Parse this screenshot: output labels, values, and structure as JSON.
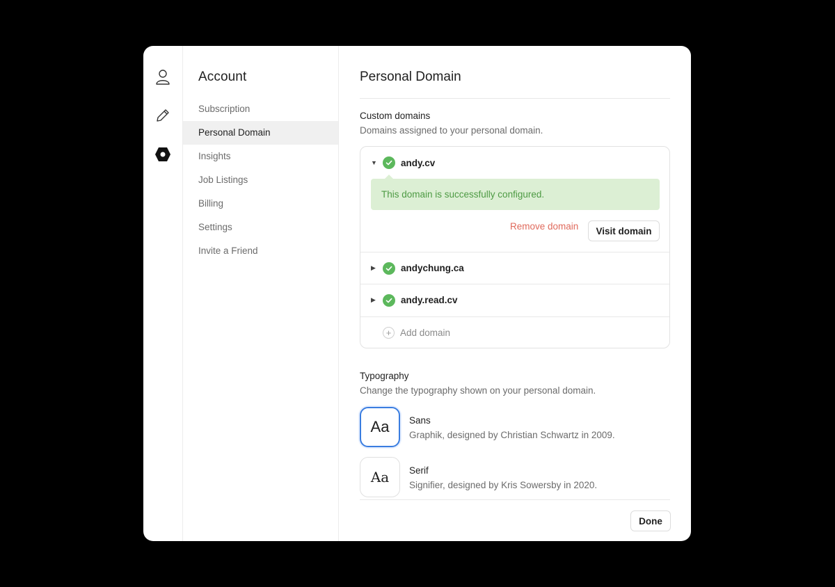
{
  "nav": {
    "title": "Account",
    "items": [
      {
        "label": "Subscription"
      },
      {
        "label": "Personal Domain"
      },
      {
        "label": "Insights"
      },
      {
        "label": "Job Listings"
      },
      {
        "label": "Billing"
      },
      {
        "label": "Settings"
      },
      {
        "label": "Invite a Friend"
      }
    ],
    "active_item": "Personal Domain"
  },
  "rail": {
    "icons": [
      "user-icon",
      "pencil-icon",
      "hexagon-icon"
    ]
  },
  "main": {
    "title": "Personal Domain",
    "custom_domains": {
      "title": "Custom domains",
      "description": "Domains assigned to your personal domain.",
      "domains": [
        {
          "name": "andy.cv",
          "expanded": true,
          "status": "configured"
        },
        {
          "name": "andychung.ca",
          "expanded": false,
          "status": "configured"
        },
        {
          "name": "andy.read.cv",
          "expanded": false,
          "status": "configured"
        }
      ],
      "success_message": "This domain is successfully configured.",
      "remove_label": "Remove domain",
      "visit_label": "Visit domain",
      "add_label": "Add domain"
    },
    "typography": {
      "title": "Typography",
      "description": "Change the typography shown on your personal domain.",
      "options": [
        {
          "sample": "Aa",
          "name": "Sans",
          "description": "Graphik, designed by Christian Schwartz in 2009.",
          "selected": true
        },
        {
          "sample": "Aa",
          "name": "Serif",
          "description": "Signifier, designed by Kris Sowersby in 2020.",
          "selected": false
        }
      ]
    },
    "done_label": "Done"
  },
  "colors": {
    "accent_blue": "#3a7de0",
    "success_green": "#5cb85c",
    "success_bg": "#dcefd4",
    "danger_red": "#e06a5c"
  }
}
